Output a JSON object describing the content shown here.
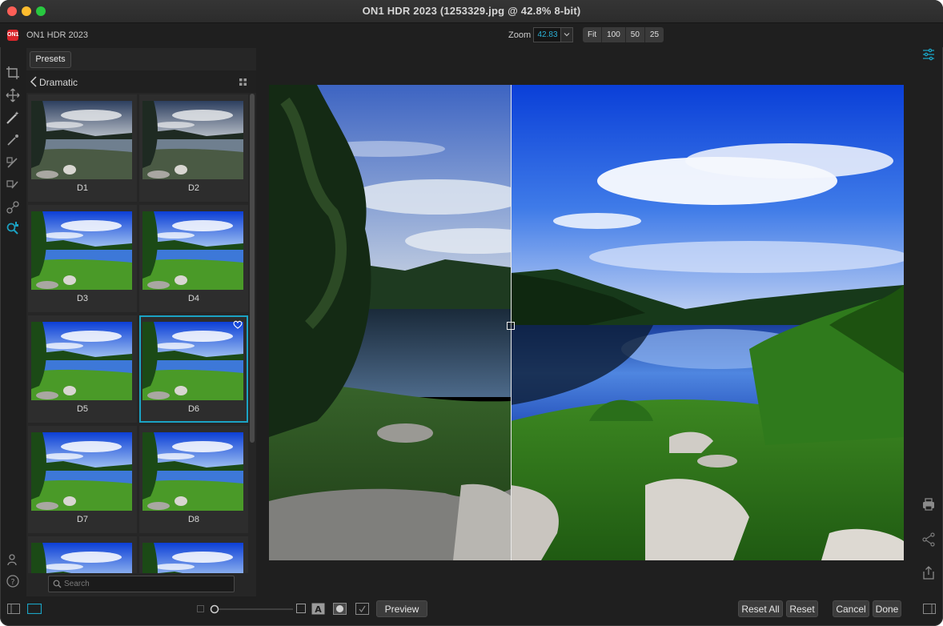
{
  "window": {
    "title": "ON1 HDR 2023 (1253329.jpg @ 42.8% 8-bit)"
  },
  "app": {
    "name": "ON1 HDR 2023"
  },
  "zoom": {
    "label": "Zoom",
    "value": "42.83",
    "buttons": [
      "Fit",
      "100",
      "50",
      "25"
    ]
  },
  "presets": {
    "tab_label": "Presets",
    "category": "Dramatic",
    "items": [
      {
        "label": "D1"
      },
      {
        "label": "D2"
      },
      {
        "label": "D3"
      },
      {
        "label": "D4"
      },
      {
        "label": "D5"
      },
      {
        "label": "D6",
        "selected": true
      },
      {
        "label": "D7"
      },
      {
        "label": "D8"
      }
    ],
    "search_placeholder": "Search"
  },
  "bottom": {
    "preview_label": "Preview",
    "reset_all_label": "Reset All",
    "reset_label": "Reset",
    "cancel_label": "Cancel",
    "done_label": "Done"
  },
  "colors": {
    "accent": "#1ba3c4",
    "background": "#1f1f1f",
    "panel": "#262626"
  }
}
